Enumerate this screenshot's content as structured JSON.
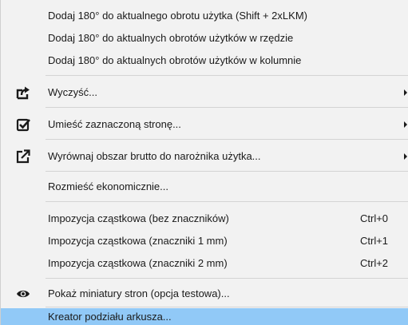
{
  "menu": {
    "items": [
      {
        "label": "Dodaj 180° do aktualnego obrotu użytka (Shift + 2xLKM)"
      },
      {
        "label": "Dodaj 180° do aktualnych obrotów użytków w rzędzie"
      },
      {
        "label": "Dodaj 180° do aktualnych obrotów użytków w kolumnie"
      },
      {
        "label": "Wyczyść...",
        "icon": "arrow-share-icon"
      },
      {
        "label": "Umieść zaznaczoną stronę...",
        "icon": "checkbox-check-icon"
      },
      {
        "label": "Wyrównaj obszar brutto do narożnika użytka...",
        "icon": "external-link-icon"
      },
      {
        "label": "Rozmieść ekonomicznie..."
      },
      {
        "label": "Impozycja cząstkowa (bez znaczników)",
        "shortcut": "Ctrl+0"
      },
      {
        "label": "Impozycja cząstkowa (znaczniki 1 mm)",
        "shortcut": "Ctrl+1"
      },
      {
        "label": "Impozycja cząstkowa (znaczniki 2 mm)",
        "shortcut": "Ctrl+2"
      },
      {
        "label": "Pokaż miniatury stron (opcja testowa)...",
        "icon": "eye-icon"
      },
      {
        "label": "Kreator podziału arkusza..."
      }
    ],
    "highlight_color": "#91c9f7",
    "background_color": "#f2f2f2"
  }
}
